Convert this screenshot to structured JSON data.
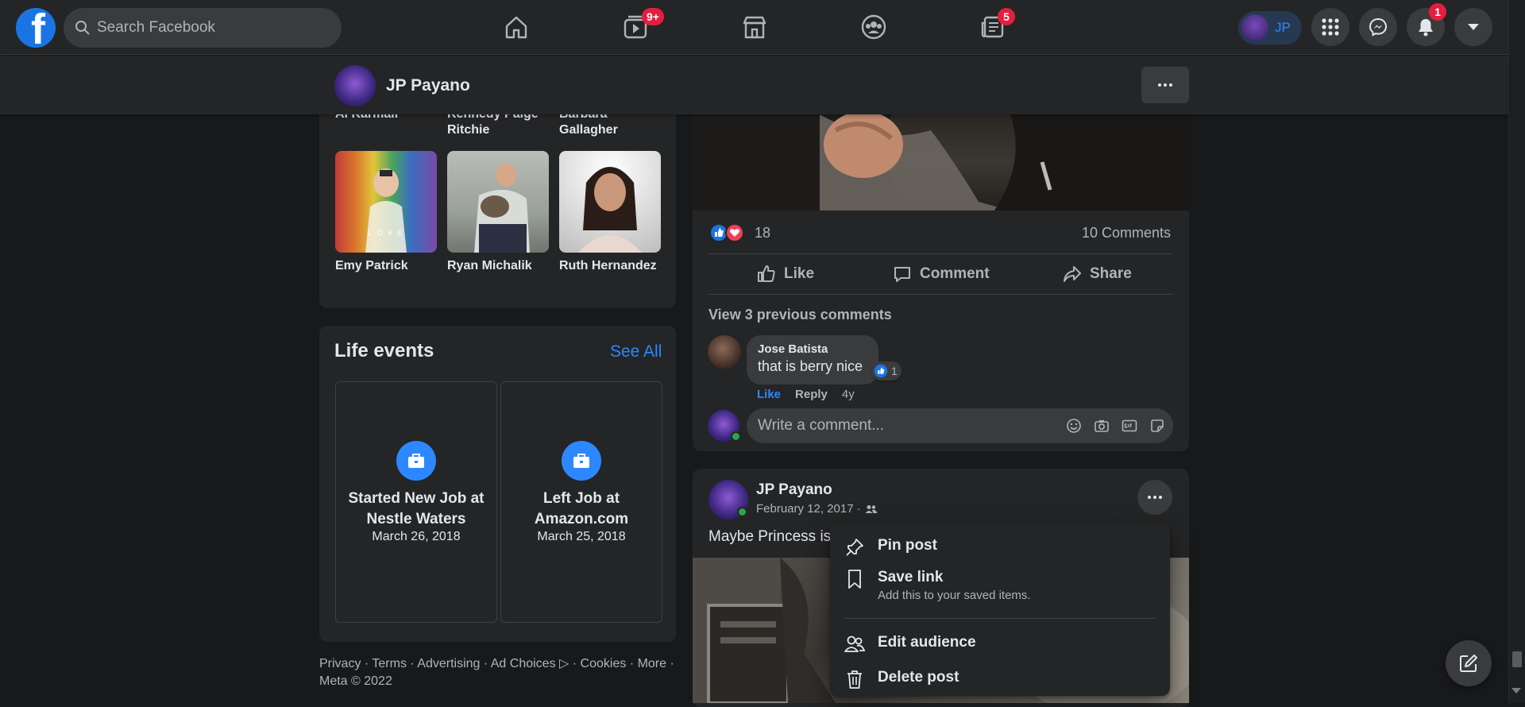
{
  "topnav": {
    "logo_letter": "f",
    "search_placeholder": "Search Facebook",
    "watch_badge": "9+",
    "gaming_badge": "5",
    "profile_initials": "JP",
    "notifications_badge": "1"
  },
  "profile_bar": {
    "name": "JP Payano"
  },
  "friends": {
    "cut_names": [
      "Al Karmali",
      "Kennedy Paige Ritchie",
      "Barbara Gallagher"
    ],
    "items": [
      {
        "name": "Emy Patrick",
        "photo_text": "L O V E"
      },
      {
        "name": "Ryan Michalik"
      },
      {
        "name": "Ruth Hernandez"
      }
    ]
  },
  "life_events": {
    "title": "Life events",
    "see_all": "See All",
    "items": [
      {
        "title": "Started New Job at Nestle Waters",
        "date": "March 26, 2018"
      },
      {
        "title": "Left Job at Amazon.com",
        "date": "March 25, 2018"
      }
    ]
  },
  "footer": {
    "line1": "Privacy · Terms · Advertising · Ad Choices ▷ · Cookies · More ·",
    "line2": "Meta © 2022"
  },
  "post1": {
    "reaction_count": "18",
    "comments_count": "10 Comments",
    "like_label": "Like",
    "comment_label": "Comment",
    "share_label": "Share",
    "view_previous": "View 3 previous comments",
    "comment": {
      "author": "Jose Batista",
      "text": "that is berry nice",
      "reactions": "1",
      "like": "Like",
      "reply": "Reply",
      "time": "4y"
    },
    "write_placeholder": "Write a comment..."
  },
  "post2": {
    "author": "JP Payano",
    "date": "February 12, 2017 ·",
    "text": "Maybe Princess is a"
  },
  "post_menu": {
    "items": [
      {
        "label": "Pin post",
        "icon": "pin-icon"
      },
      {
        "label": "Save link",
        "sub": "Add this to your saved items.",
        "icon": "bookmark-icon"
      },
      {
        "label": "Edit audience",
        "icon": "people-icon"
      },
      {
        "label": "Delete post",
        "icon": "trash-icon"
      }
    ]
  },
  "colors": {
    "background": "#18191a",
    "surface": "#242526",
    "accent": "#2d88ff",
    "badge": "#e41e3f",
    "online": "#31a24c"
  }
}
